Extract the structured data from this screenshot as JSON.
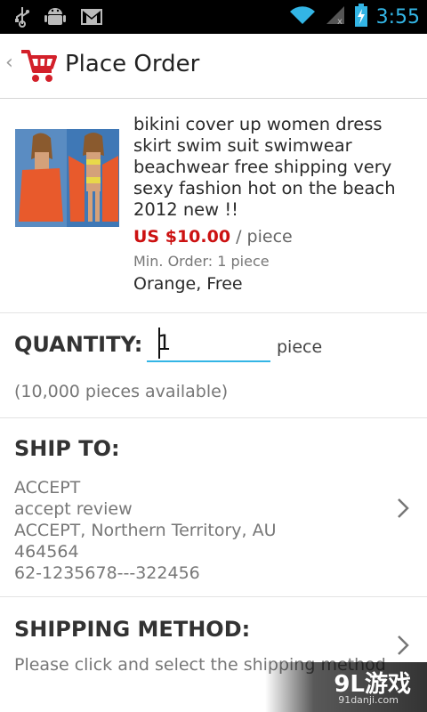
{
  "status_bar": {
    "time": "3:55",
    "icons": [
      "usb-icon",
      "android-debug-icon",
      "gmail-icon",
      "wifi-icon",
      "signal-icon",
      "battery-charging-icon"
    ]
  },
  "action_bar": {
    "title": "Place Order",
    "back_glyph": "‹",
    "icon": "shopping-cart-icon"
  },
  "product": {
    "name": "bikini cover up  women dress skirt swim suit swimwear beachwear  free shipping very sexy fashion  hot on the beach 2012 new !!",
    "price": "US $10.00",
    "price_unit": "/ piece",
    "min_order": "Min. Order: 1 piece",
    "variant": "Orange, Free"
  },
  "quantity": {
    "label": "QUANTITY:",
    "value": "1",
    "unit": "piece",
    "available": "(10,000 pieces available)"
  },
  "ship_to": {
    "label": "SHIP TO:",
    "lines": [
      "ACCEPT",
      "accept review",
      "ACCEPT, Northern Territory, AU",
      "464564",
      "62-1235678---322456"
    ]
  },
  "shipping_method": {
    "label": "SHIPPING METHOD:",
    "hint": "Please click and select the shipping method"
  },
  "watermark": {
    "main": "9L游戏",
    "sub": "91danji.com"
  },
  "colors": {
    "accent": "#33b5e5",
    "price": "#cc1111",
    "brand": "#d3202a"
  }
}
